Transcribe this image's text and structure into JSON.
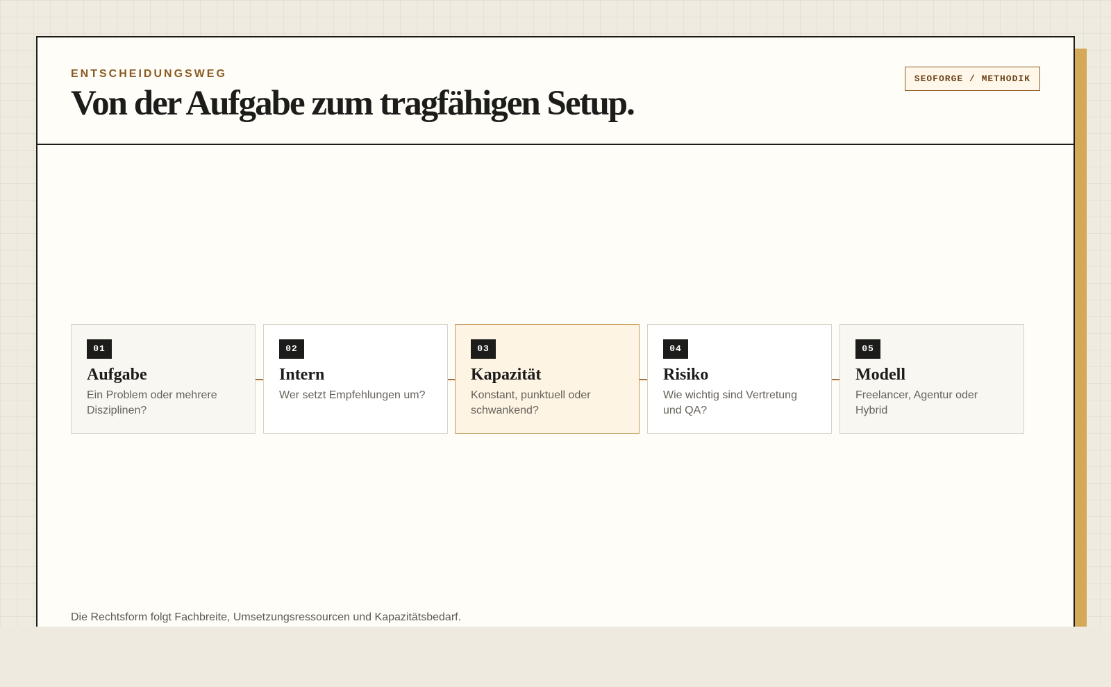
{
  "header": {
    "eyebrow": "ENTSCHEIDUNGSWEG",
    "title": "Von der Aufgabe zum tragfähigen Setup.",
    "badge": "SEOFORGE / METHODIK"
  },
  "steps": [
    {
      "number": "01",
      "title": "Aufgabe",
      "description": "Ein Problem oder mehrere Disziplinen?"
    },
    {
      "number": "02",
      "title": "Intern",
      "description": "Wer setzt Empfehlungen um?"
    },
    {
      "number": "03",
      "title": "Kapazität",
      "description": "Konstant, punktuell oder schwankend?"
    },
    {
      "number": "04",
      "title": "Risiko",
      "description": "Wie wichtig sind Vertretung und QA?"
    },
    {
      "number": "05",
      "title": "Modell",
      "description": "Freelancer, Agentur oder Hybrid"
    }
  ],
  "footer": {
    "note": "Die Rechtsform folgt Fachbreite, Umsetzungsressourcen und Kapazitätsbedarf."
  },
  "colors": {
    "accent": "#8a5a22",
    "highlight_step": "#fdf4e4",
    "shadow_block": "#d6a95a",
    "ink": "#1c1c1a"
  }
}
